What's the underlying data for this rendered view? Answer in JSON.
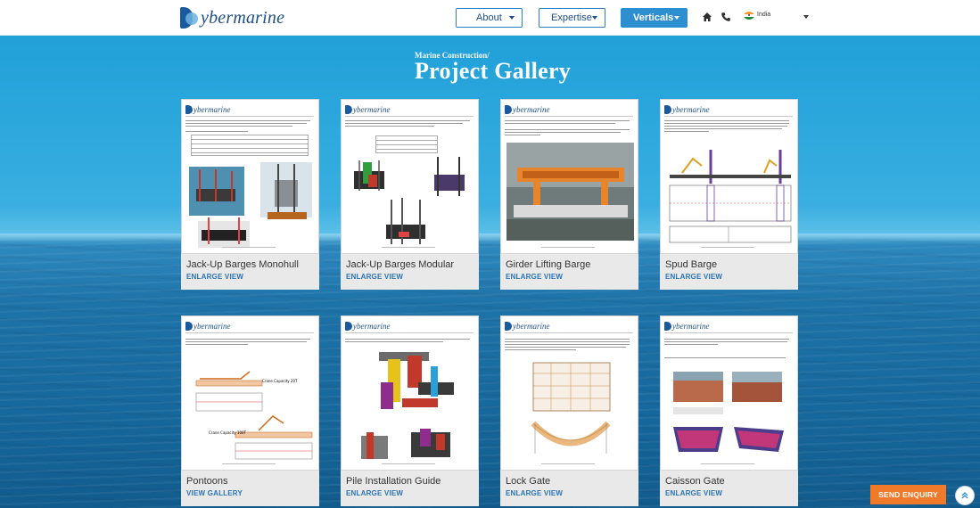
{
  "header": {
    "logo_text": "ybermarine",
    "nav": [
      {
        "label": "About"
      },
      {
        "label": "Expertise"
      },
      {
        "label": "Verticals"
      }
    ],
    "country": "India",
    "icons": [
      "home-icon",
      "phone-icon",
      "india-flag-icon"
    ]
  },
  "page": {
    "subtitle": "Marine Construction/",
    "title": "Project Gallery"
  },
  "gallery": [
    {
      "caption": "Jack-Up Barges Monohull",
      "link": "ENLARGE VIEW"
    },
    {
      "caption": "Jack-Up Barges Modular",
      "link": "ENLARGE VIEW"
    },
    {
      "caption": "Girder Lifting Barge",
      "link": "ENLARGE VIEW"
    },
    {
      "caption": "Spud Barge",
      "link": "ENLARGE VIEW"
    },
    {
      "caption": "Pontoons",
      "link": "VIEW GALLERY"
    },
    {
      "caption": "Pile Installation Guide",
      "link": "ENLARGE VIEW"
    },
    {
      "caption": "Lock Gate",
      "link": "ENLARGE VIEW"
    },
    {
      "caption": "Caisson Gate",
      "link": "ENLARGE VIEW"
    }
  ],
  "doc_logo_text": "ybermarine",
  "floating": {
    "enquiry_label": "SEND ENQUIRY",
    "scroll_icon": "chevron-up-icon"
  },
  "colors": {
    "brand_blue": "#1f4f86",
    "accent_blue": "#2e8fd0",
    "link_blue": "#2a73b7",
    "enquiry_orange": "#f07a2a"
  }
}
